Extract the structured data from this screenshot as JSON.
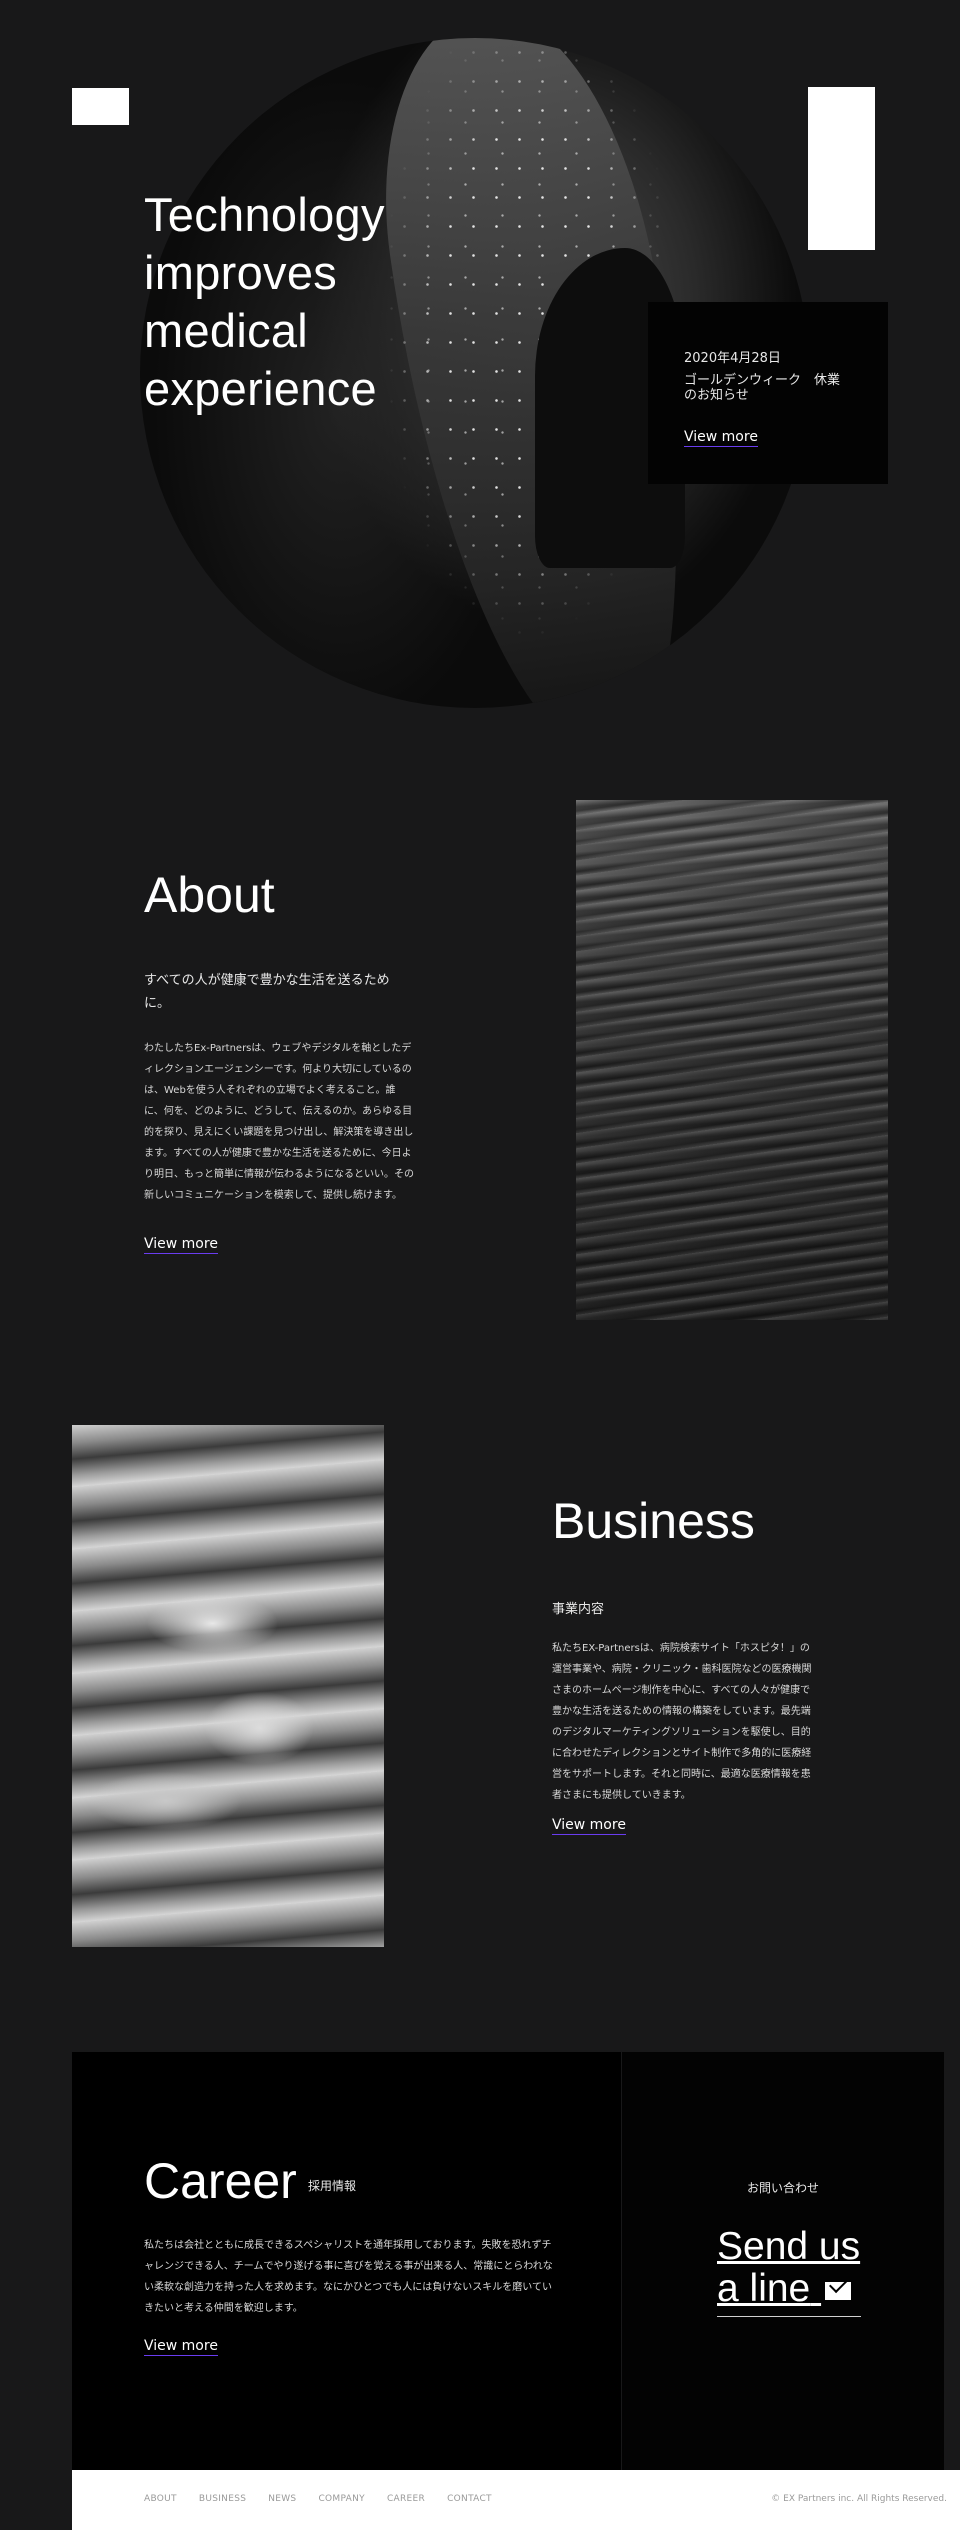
{
  "hero": {
    "title": "Technology improves medical experience"
  },
  "news": {
    "date": "2020年4月28日",
    "title": "ゴールデンウィーク　休業のお知らせ",
    "link": "View more"
  },
  "about": {
    "title": "About",
    "lead": "すべての人が健康で豊かな生活を送るために。",
    "body": "わたしたちEx-Partnersは、ウェブやデジタルを軸としたディレクションエージェンシーです。何より大切にしているのは、Webを使う人それぞれの立場でよく考えること。誰に、何を、どのように、どうして、伝えるのか。あらゆる目的を探り、見えにくい課題を見つけ出し、解決策を導き出します。すべての人が健康で豊かな生活を送るために、今日より明日、もっと簡単に情報が伝わるようになるといい。その新しいコミュニケーションを模索して、提供し続けます。",
    "link": "View more"
  },
  "business": {
    "title": "Business",
    "lead": "事業内容",
    "body": "私たちEX-Partnersは、病院検索サイト「ホスピタ！」の運営事業や、病院・クリニック・歯科医院などの医療機関さまのホームページ制作を中心に、すべての人々が健康で豊かな生活を送るための情報の構築をしています。最先端のデジタルマーケティングソリューションを駆使し、目的に合わせたディレクションとサイト制作で多角的に医療経営をサポートします。それと同時に、最適な医療情報を患者さまにも提供していきます。",
    "link": "View more"
  },
  "career": {
    "title": "Career",
    "subtitle": "採用情報",
    "body": "私たちは会社とともに成長できるスペシャリストを通年採用しております。失敗を恐れずチャレンジできる人、チームでやり遂げる事に喜びを覚える事が出来る人、常識にとらわれない柔軟な創造力を持った人を求めます。なにかひとつでも人には負けないスキルを磨いていきたいと考える仲間を歓迎します。",
    "link": "View more"
  },
  "contact": {
    "label": "お問い合わせ",
    "cta_line1": "Send us",
    "cta_line2": "a line",
    "icon": "mail-icon"
  },
  "footer": {
    "nav": [
      "ABOUT",
      "BUSINESS",
      "NEWS",
      "COMPANY",
      "CAREER",
      "CONTACT"
    ],
    "copyright": "© EX Partners inc. All Rights Reserved."
  },
  "colors": {
    "background": "#181819",
    "panel": "#000000",
    "accent_underline": "#6a3cf0",
    "footer": "#ffffff"
  }
}
